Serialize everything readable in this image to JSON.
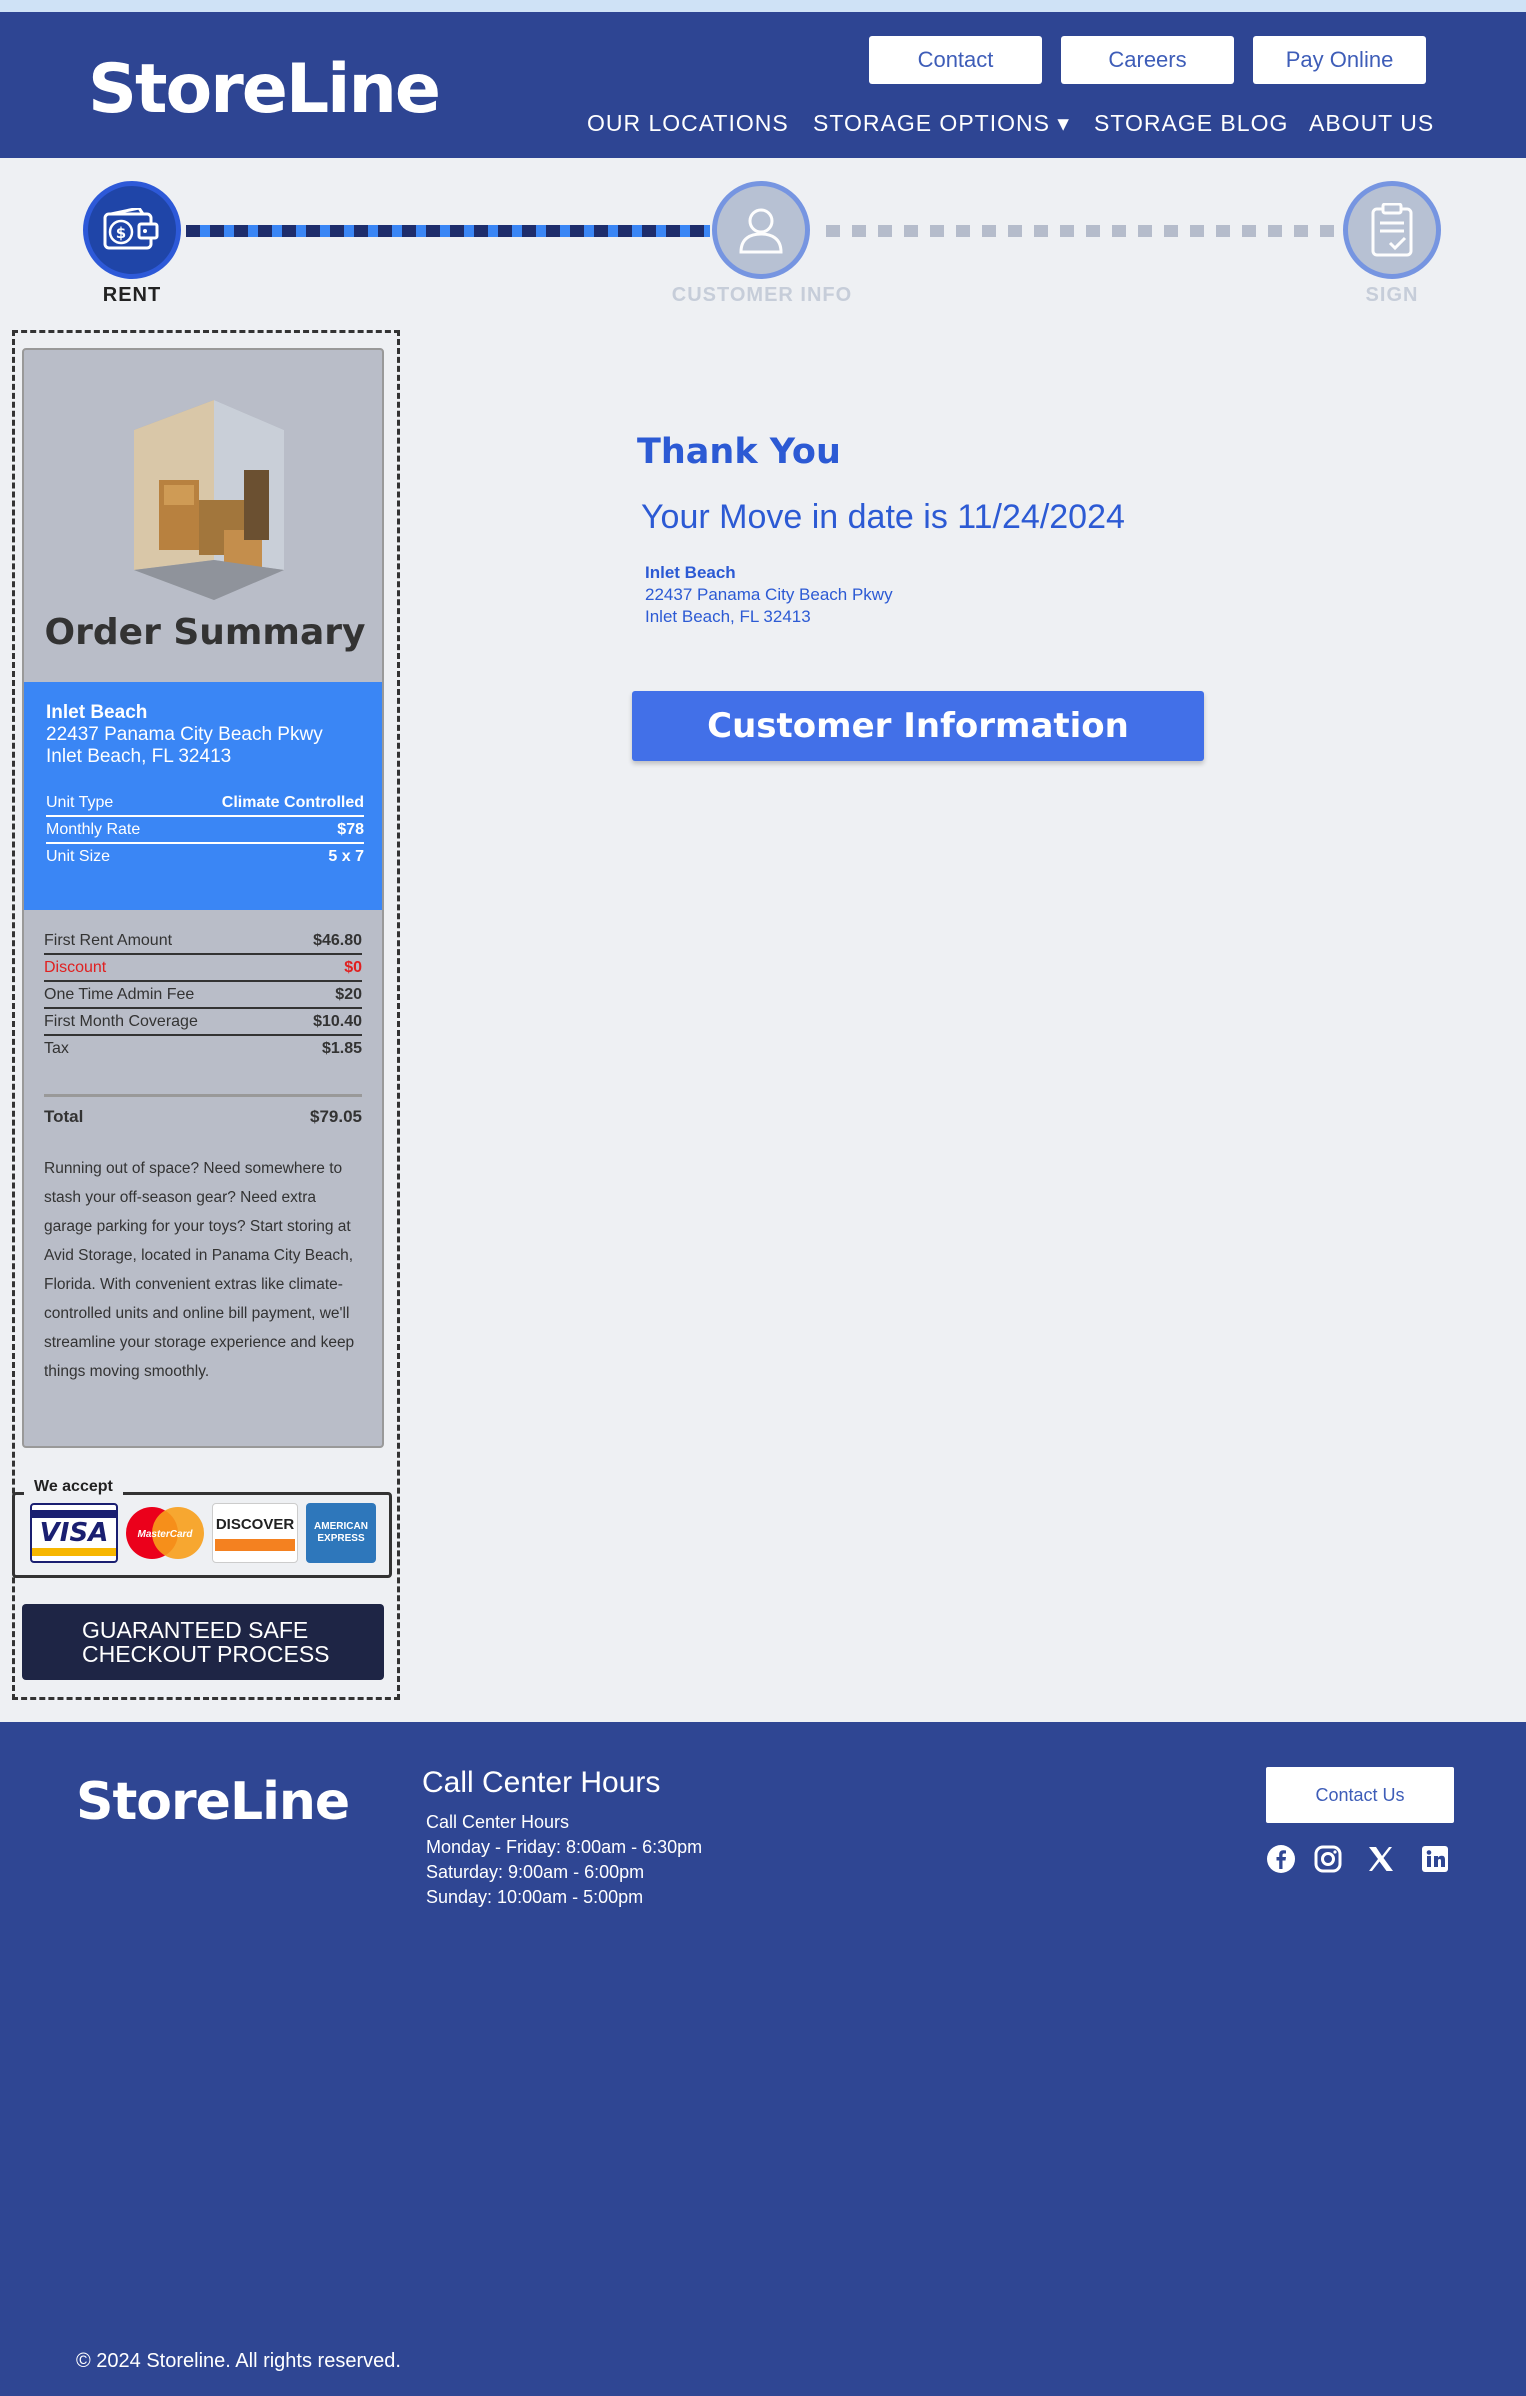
{
  "brand": {
    "logo": "StoreLine"
  },
  "header": {
    "buttons": {
      "contact": "Contact",
      "careers": "Careers",
      "pay_online": "Pay Online"
    },
    "nav": {
      "locations": "OUR LOCATIONS",
      "storage_options": "STORAGE OPTIONS ▾",
      "blog": "STORAGE BLOG",
      "about": "ABOUT US"
    }
  },
  "stepper": {
    "steps": [
      {
        "label": "RENT",
        "icon": "wallet-money-icon",
        "state": "active"
      },
      {
        "label": "CUSTOMER INFO",
        "icon": "user-icon",
        "state": "inactive"
      },
      {
        "label": "SIGN",
        "icon": "clipboard-check-icon",
        "state": "inactive"
      }
    ]
  },
  "order_summary": {
    "title": "Order Summary",
    "location": {
      "name": "Inlet Beach",
      "street": "22437 Panama City Beach Pkwy",
      "city": "Inlet Beach, FL 32413"
    },
    "unit": [
      {
        "label": "Unit Type",
        "value": "Climate Controlled"
      },
      {
        "label": "Monthly Rate",
        "value": "$78"
      },
      {
        "label": "Unit Size",
        "value": "5 x 7"
      }
    ],
    "costs": [
      {
        "label": "First Rent Amount",
        "value": "$46.80"
      },
      {
        "label": "Discount",
        "value": "$0"
      },
      {
        "label": "One Time Admin Fee",
        "value": "$20"
      },
      {
        "label": "First Month Coverage",
        "value": "$10.40"
      },
      {
        "label": "Tax",
        "value": "$1.85"
      }
    ],
    "total": {
      "label": "Total",
      "value": "$79.05"
    },
    "description": "Running out of space? Need somewhere to stash your off-season gear? Need extra garage parking for your toys? Start storing at Avid Storage, located in Panama City Beach, Florida. With convenient extras like climate-controlled units and online bill payment, we'll streamline your storage experience and keep things moving smoothly."
  },
  "payments": {
    "label": "We accept",
    "cards": [
      "VISA",
      "MasterCard",
      "DISCOVER",
      "AMERICAN EXPRESS"
    ]
  },
  "guarantee": {
    "line1": "GUARANTEED SAFE",
    "line2": "CHECKOUT PROCESS"
  },
  "confirmation": {
    "heading": "Thank You",
    "move_in": "Your Move in date is 11/24/2024",
    "location_name": "Inlet Beach",
    "location_street": "22437 Panama City Beach Pkwy",
    "location_city": "Inlet Beach, FL 32413",
    "button": "Customer Information"
  },
  "footer": {
    "logo": "StoreLine",
    "hours_title": "Call Center Hours",
    "hours": [
      "Call Center Hours",
      "Monday - Friday: 8:00am - 6:30pm",
      "Saturday: 9:00am - 6:00pm",
      "Sunday: 10:00am - 5:00pm"
    ],
    "contact_button": "Contact Us",
    "social": [
      "facebook-icon",
      "instagram-icon",
      "x-icon",
      "linkedin-icon"
    ],
    "copyright": "© 2024 Storeline. All rights reserved."
  },
  "colors": {
    "header_bg": "#2e4593",
    "accent_blue": "#3a86f5",
    "primary_button": "#4270e8",
    "text_blue": "#2c5ad4",
    "discount_red": "#e02020"
  }
}
